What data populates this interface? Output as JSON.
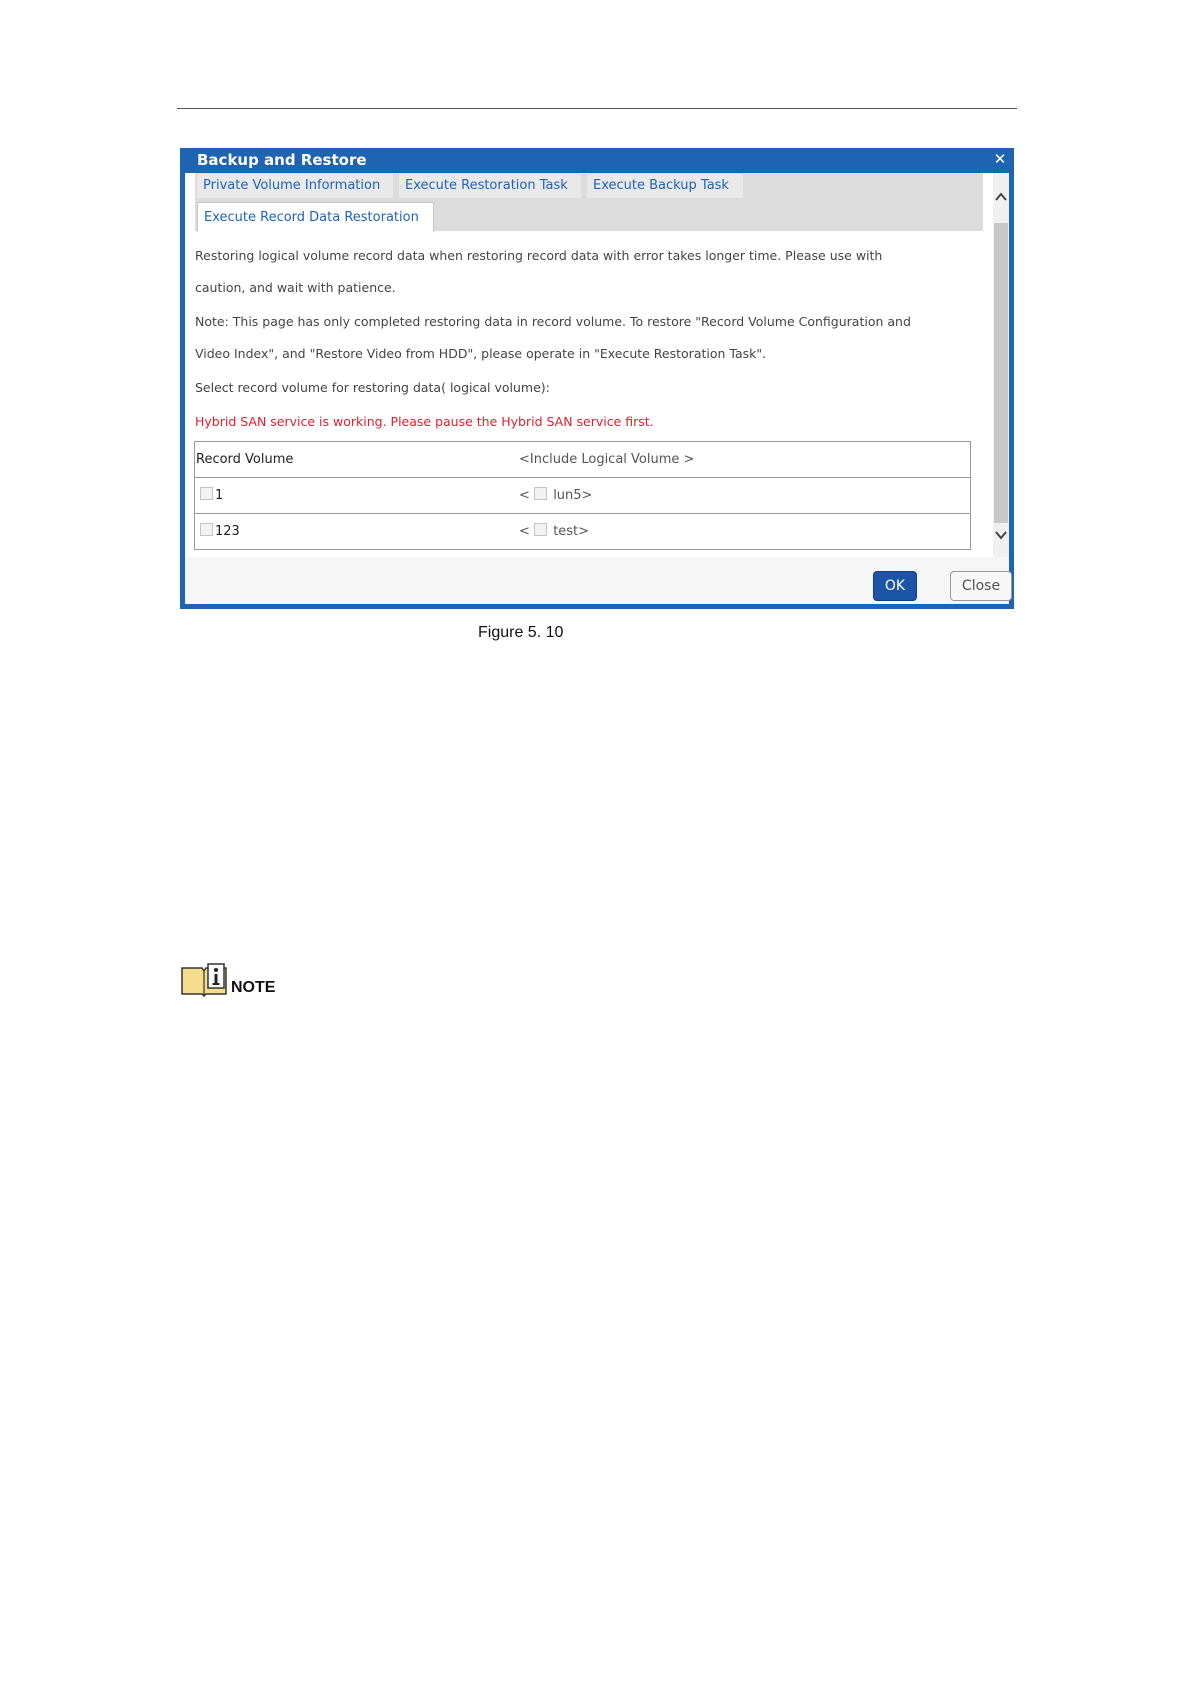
{
  "dialog": {
    "title": "Backup and Restore",
    "close_glyph": "✕",
    "tabs": [
      {
        "label": "Private Volume Information"
      },
      {
        "label": "Execute Restoration Task"
      },
      {
        "label": "Execute Backup Task"
      },
      {
        "label": "Execute Record Data Restoration"
      }
    ],
    "active_tab": "Execute Record Data Restoration",
    "messages": {
      "line1": "Restoring logical volume record data when restoring record data with error takes longer time. Please use with",
      "line2": "caution, and wait with patience.",
      "line3": "Note: This page has only completed restoring data in record volume. To restore \"Record Volume Configuration and",
      "line4": "Video Index\", and \"Restore Video from HDD\", please operate in \"Execute Restoration Task\".",
      "line5": "Select record volume for restoring data( logical volume):",
      "warning": "Hybrid SAN service is working. Please pause the Hybrid SAN service first."
    },
    "table": {
      "headers": {
        "record_volume": "Record Volume",
        "logical_volume": "<Include Logical Volume >"
      },
      "rows": [
        {
          "volume": "1",
          "prefix": "<",
          "logical": "lun5>"
        },
        {
          "volume": "123",
          "prefix": "<",
          "logical": "test>"
        }
      ]
    },
    "buttons": {
      "ok": "OK",
      "close": "Close"
    },
    "colors": {
      "title_bar": "#1f64b0",
      "tab_text": "#1e63b6",
      "warning_text": "#e0202a",
      "ok_button": "#1c55a8"
    }
  },
  "figure_caption": "Figure 5. 10",
  "note": {
    "label": "NOTE",
    "icon": "info-book-icon"
  }
}
